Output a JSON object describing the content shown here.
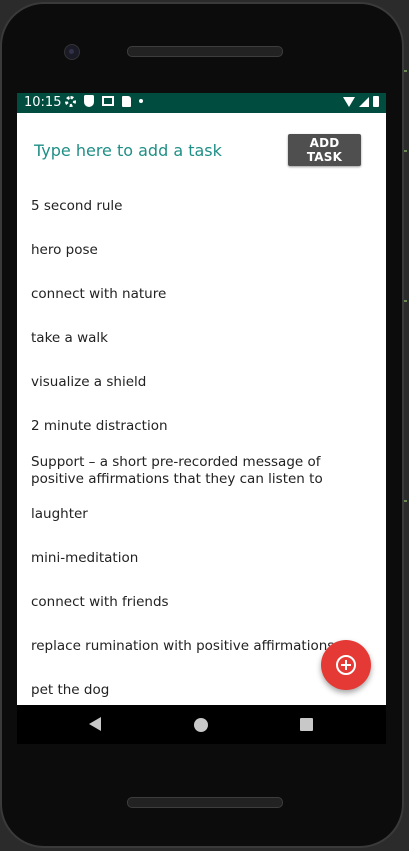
{
  "status_bar": {
    "time": "10:15",
    "left_icons": [
      "gear-icon",
      "shield-icon",
      "photo-icon",
      "sd-card-icon",
      "dot-icon"
    ],
    "right_icons": [
      "wifi-icon",
      "signal-icon",
      "battery-icon"
    ],
    "background_color": "#004d40"
  },
  "task_input": {
    "placeholder": "Type here to add a task",
    "value": "",
    "color": "#00897b"
  },
  "add_button": {
    "label": "ADD TASK",
    "color": "#4f4f4f"
  },
  "tasks": [
    "5 second rule",
    "hero pose",
    "connect with nature",
    "take a walk",
    "visualize a shield",
    "2 minute distraction",
    "Support – a short pre-recorded message of positive affirmations that they can listen to",
    "laughter",
    "mini-meditation",
    "connect with friends",
    "replace rumination with positive affirmations",
    "pet the dog"
  ],
  "fab": {
    "icon": "add-circle-icon",
    "color": "#e53935"
  },
  "nav_bar": {
    "icons": [
      "back-icon",
      "home-icon",
      "recents-icon"
    ]
  }
}
